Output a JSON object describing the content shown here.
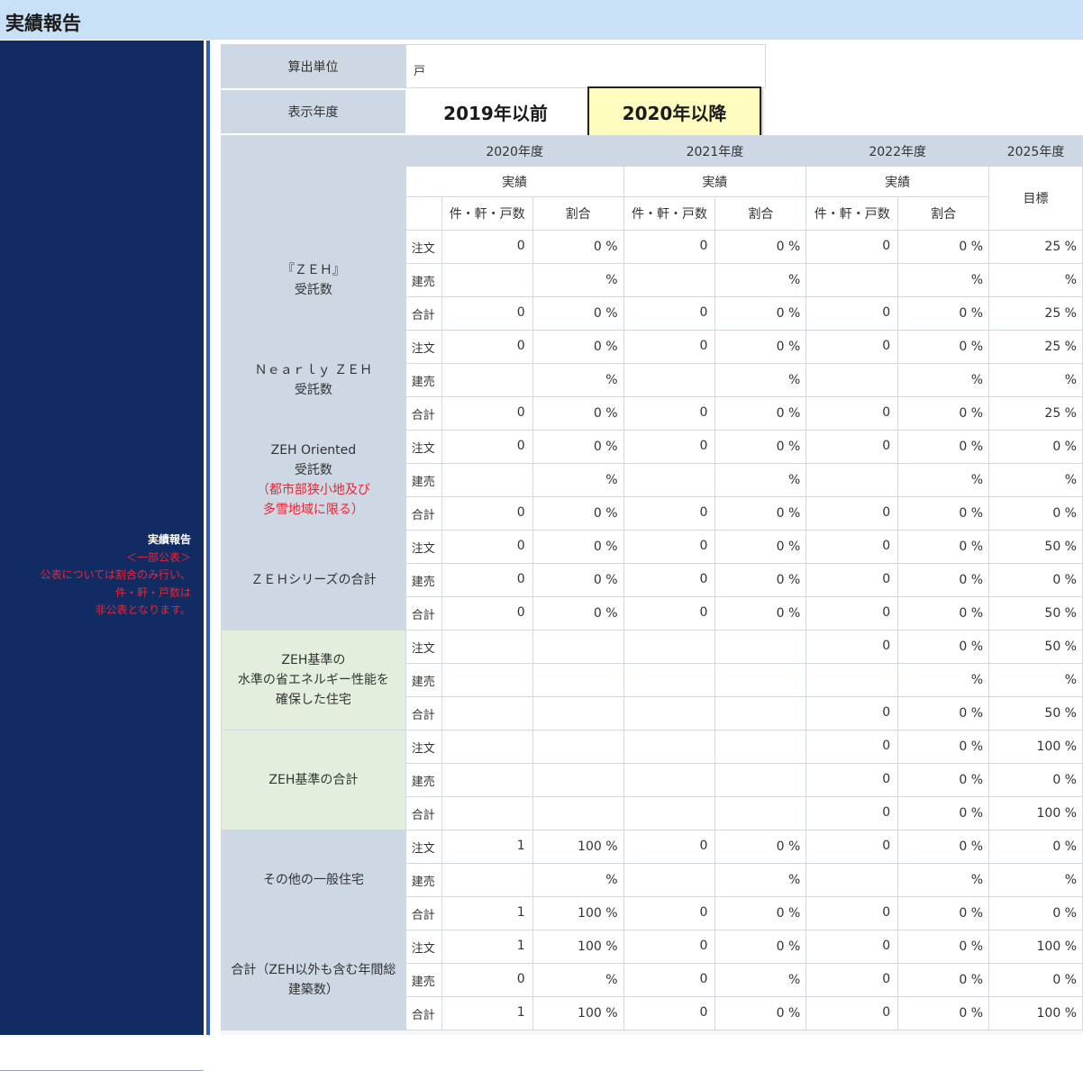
{
  "header": {
    "title": "実績報告"
  },
  "sidebar": {
    "line1": "実績報告",
    "line2": "＜一部公表＞",
    "line3": "公表については割合のみ行い、",
    "line4": "件・軒・戸数は",
    "line5": "非公表となります。"
  },
  "unit": {
    "label": "算出単位",
    "value": "戸"
  },
  "year_select": {
    "label": "表示年度",
    "before": "2019年以前",
    "after": "2020年以降",
    "selected": "2020年以降"
  },
  "table": {
    "years": [
      "2020年度",
      "2021年度",
      "2022年度",
      "2025年度"
    ],
    "actual_label": "実績",
    "target_label": "目標",
    "count_label": "件・軒・戸数",
    "ratio_label": "割合",
    "groups": [
      {
        "label_lines": [
          "『ＺＥＨ』",
          "受託数"
        ],
        "rows": [
          {
            "type": "注文",
            "c2020": "0",
            "r2020": "0 %",
            "c2021": "0",
            "r2021": "0 %",
            "c2022": "0",
            "r2022": "0 %",
            "target": "25 %"
          },
          {
            "type": "建売",
            "c2020": "",
            "r2020": "%",
            "c2021": "",
            "r2021": "%",
            "c2022": "",
            "r2022": "%",
            "target": "%"
          },
          {
            "type": "合計",
            "c2020": "0",
            "r2020": "0 %",
            "c2021": "0",
            "r2021": "0 %",
            "c2022": "0",
            "r2022": "0 %",
            "target": "25 %"
          }
        ]
      },
      {
        "label_lines": [
          "Ｎｅａｒｌｙ ＺＥＨ",
          "受託数"
        ],
        "rows": [
          {
            "type": "注文",
            "c2020": "0",
            "r2020": "0 %",
            "c2021": "0",
            "r2021": "0 %",
            "c2022": "0",
            "r2022": "0 %",
            "target": "25 %"
          },
          {
            "type": "建売",
            "c2020": "",
            "r2020": "%",
            "c2021": "",
            "r2021": "%",
            "c2022": "",
            "r2022": "%",
            "target": "%"
          },
          {
            "type": "合計",
            "c2020": "0",
            "r2020": "0 %",
            "c2021": "0",
            "r2021": "0 %",
            "c2022": "0",
            "r2022": "0 %",
            "target": "25 %"
          }
        ]
      },
      {
        "label_lines": [
          "ZEH Oriented",
          "受託数"
        ],
        "label_red_lines": [
          "（都市部狭小地及び",
          "多雪地域に限る）"
        ],
        "rows": [
          {
            "type": "注文",
            "c2020": "0",
            "r2020": "0 %",
            "c2021": "0",
            "r2021": "0 %",
            "c2022": "0",
            "r2022": "0 %",
            "target": "0 %"
          },
          {
            "type": "建売",
            "c2020": "",
            "r2020": "%",
            "c2021": "",
            "r2021": "%",
            "c2022": "",
            "r2022": "%",
            "target": "%"
          },
          {
            "type": "合計",
            "c2020": "0",
            "r2020": "0 %",
            "c2021": "0",
            "r2021": "0 %",
            "c2022": "0",
            "r2022": "0 %",
            "target": "0 %"
          }
        ]
      },
      {
        "label_lines": [
          "ＺＥＨシリーズの合計"
        ],
        "rows": [
          {
            "type": "注文",
            "c2020": "0",
            "r2020": "0 %",
            "c2021": "0",
            "r2021": "0 %",
            "c2022": "0",
            "r2022": "0 %",
            "target": "50 %"
          },
          {
            "type": "建売",
            "c2020": "0",
            "r2020": "0 %",
            "c2021": "0",
            "r2021": "0 %",
            "c2022": "0",
            "r2022": "0 %",
            "target": "0 %"
          },
          {
            "type": "合計",
            "c2020": "0",
            "r2020": "0 %",
            "c2021": "0",
            "r2021": "0 %",
            "c2022": "0",
            "r2022": "0 %",
            "target": "50 %"
          }
        ]
      },
      {
        "label_lines": [
          "ZEH基準の",
          "水準の省エネルギー性能を",
          "確保した住宅"
        ],
        "green": true,
        "rows": [
          {
            "type": "注文",
            "c2020": "",
            "r2020": "",
            "c2021": "",
            "r2021": "",
            "c2022": "0",
            "r2022": "0 %",
            "target": "50 %"
          },
          {
            "type": "建売",
            "c2020": "",
            "r2020": "",
            "c2021": "",
            "r2021": "",
            "c2022": "",
            "r2022": "%",
            "target": "%"
          },
          {
            "type": "合計",
            "c2020": "",
            "r2020": "",
            "c2021": "",
            "r2021": "",
            "c2022": "0",
            "r2022": "0 %",
            "target": "50 %"
          }
        ]
      },
      {
        "label_lines": [
          "ZEH基準の合計"
        ],
        "green": true,
        "rows": [
          {
            "type": "注文",
            "c2020": "",
            "r2020": "",
            "c2021": "",
            "r2021": "",
            "c2022": "0",
            "r2022": "0 %",
            "target": "100 %"
          },
          {
            "type": "建売",
            "c2020": "",
            "r2020": "",
            "c2021": "",
            "r2021": "",
            "c2022": "0",
            "r2022": "0 %",
            "target": "0 %"
          },
          {
            "type": "合計",
            "c2020": "",
            "r2020": "",
            "c2021": "",
            "r2021": "",
            "c2022": "0",
            "r2022": "0 %",
            "target": "100 %"
          }
        ]
      },
      {
        "label_lines": [
          "その他の一般住宅"
        ],
        "rows": [
          {
            "type": "注文",
            "c2020": "1",
            "r2020": "100 %",
            "c2021": "0",
            "r2021": "0 %",
            "c2022": "0",
            "r2022": "0 %",
            "target": "0 %"
          },
          {
            "type": "建売",
            "c2020": "",
            "r2020": "%",
            "c2021": "",
            "r2021": "%",
            "c2022": "",
            "r2022": "%",
            "target": "%"
          },
          {
            "type": "合計",
            "c2020": "1",
            "r2020": "100 %",
            "c2021": "0",
            "r2021": "0 %",
            "c2022": "0",
            "r2022": "0 %",
            "target": "0 %"
          }
        ]
      },
      {
        "label_lines": [
          "合計（ZEH以外も含む年間総",
          "建築数）"
        ],
        "rows": [
          {
            "type": "注文",
            "c2020": "1",
            "r2020": "100 %",
            "c2021": "0",
            "r2021": "0 %",
            "c2022": "0",
            "r2022": "0 %",
            "target": "100 %"
          },
          {
            "type": "建売",
            "c2020": "0",
            "r2020": "%",
            "c2021": "0",
            "r2021": "%",
            "c2022": "0",
            "r2022": "0 %",
            "target": "0 %"
          },
          {
            "type": "合計",
            "c2020": "1",
            "r2020": "100 %",
            "c2021": "0",
            "r2021": "0 %",
            "c2022": "0",
            "r2022": "0 %",
            "target": "100 %"
          }
        ]
      }
    ]
  }
}
